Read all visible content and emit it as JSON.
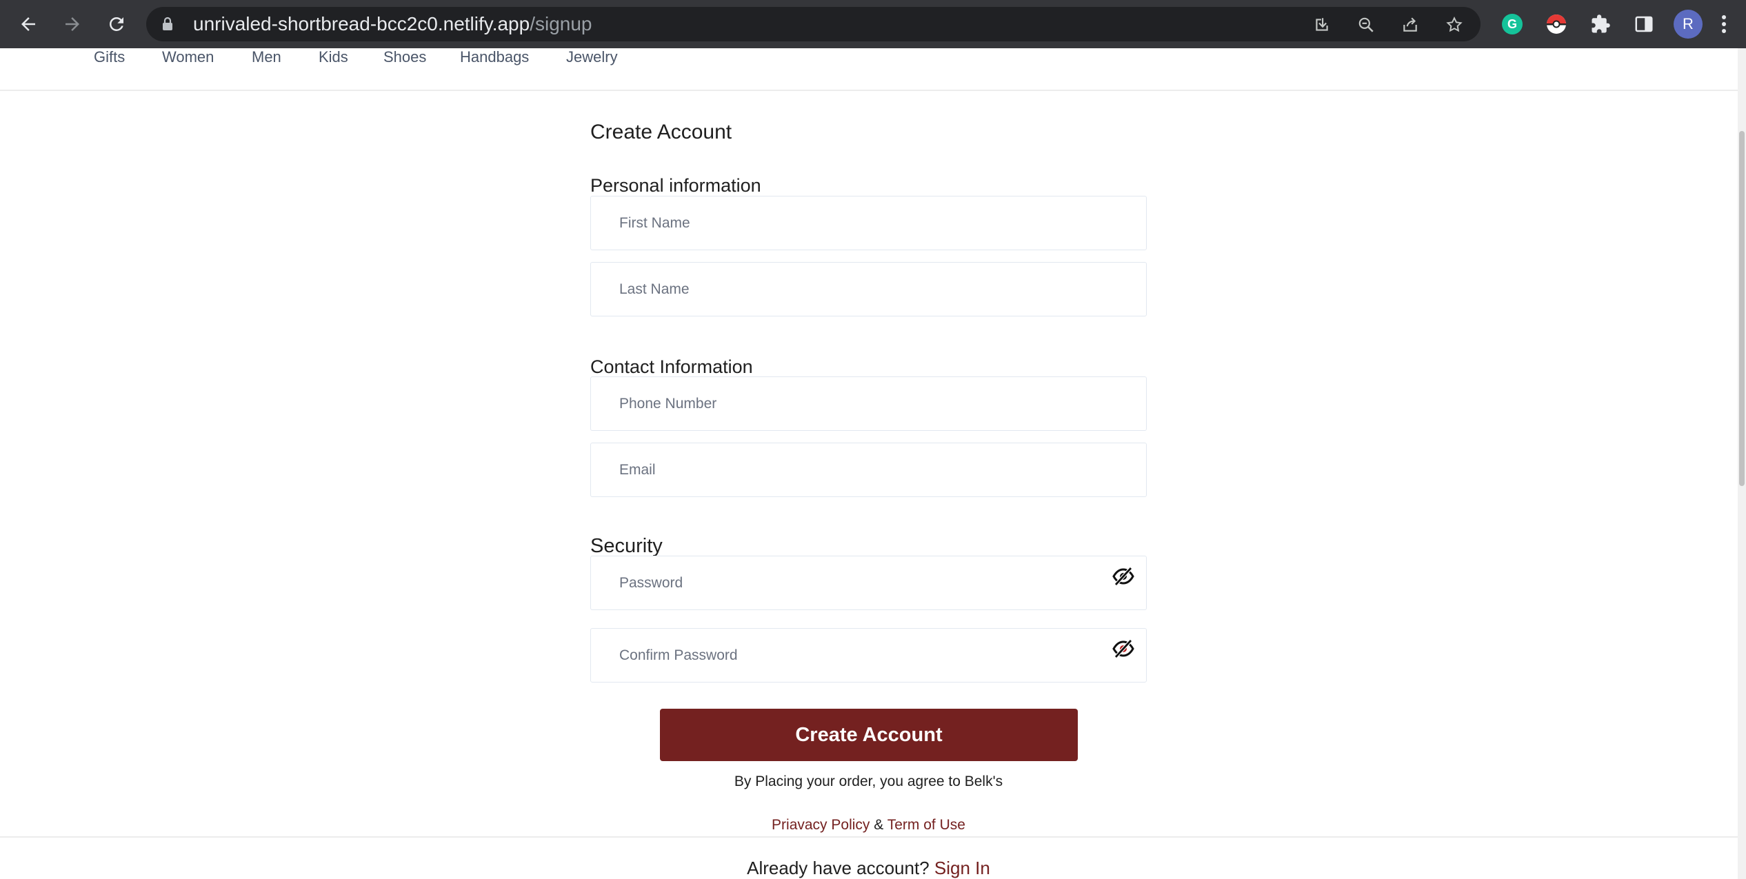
{
  "browser": {
    "url_host": "unrivaled-shortbread-bcc2c0.netlify.app",
    "url_path": "/signup",
    "profile_initial": "R"
  },
  "nav": {
    "items": [
      "Gifts",
      "Women",
      "Men",
      "Kids",
      "Shoes",
      "Handbags",
      "Jewelry"
    ]
  },
  "form": {
    "title": "Create Account",
    "personal_label": "Personal information",
    "contact_label": "Contact Information",
    "security_label": "Security",
    "first_name_placeholder": "First Name",
    "last_name_placeholder": "Last Name",
    "phone_placeholder": "Phone Number",
    "email_placeholder": "Email",
    "password_placeholder": "Password",
    "confirm_password_placeholder": "Confirm Password",
    "submit_label": "Create Account",
    "agree_text": "By Placing your order, you agree to Belk's",
    "privacy_link": "Priavacy Policy",
    "amp": "&",
    "terms_link": "Term of Use",
    "already_text": "Already have account?",
    "signin_link": "Sign In"
  },
  "colors": {
    "brand": "#742120",
    "chrome_bg": "#35363a",
    "omnibox_bg": "#202124"
  }
}
